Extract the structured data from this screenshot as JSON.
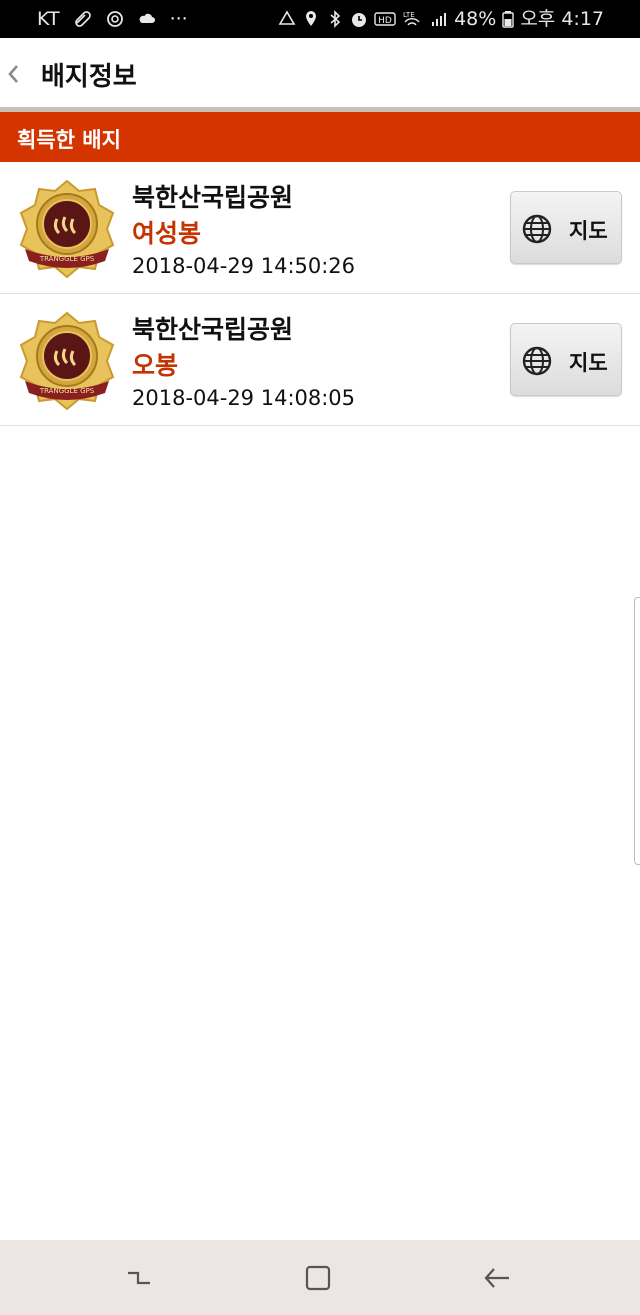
{
  "status_bar": {
    "carrier": "KT",
    "dots": "···",
    "battery_percent": "48%",
    "time": "오후 4:17",
    "icons": [
      "key-icon",
      "alarm-icon",
      "cloud-icon",
      "vibrate-icon",
      "location-icon",
      "bluetooth-icon",
      "clock-icon",
      "hd-icon",
      "lte-wifi-icon",
      "signal-icon",
      "battery-icon"
    ]
  },
  "app_bar": {
    "back_icon": "chevron-left-icon",
    "title": "배지정보"
  },
  "section": {
    "title": "획득한 배지"
  },
  "badges": [
    {
      "park": "북한산국립공원",
      "peak": "여성봉",
      "date": "2018-04-29 14:50:26",
      "map_label": "지도",
      "badge_text": "TRANGGLE GPS"
    },
    {
      "park": "북한산국립공원",
      "peak": "오봉",
      "date": "2018-04-29 14:08:05",
      "map_label": "지도",
      "badge_text": "TRANGGLE GPS"
    }
  ],
  "nav_bar": {
    "icons": [
      "recents-icon",
      "home-icon",
      "back-icon"
    ]
  },
  "colors": {
    "accent": "#d33400",
    "peak_text": "#c43400",
    "status_bar_bg": "#000000",
    "nav_bar_bg": "#ede4e4"
  }
}
